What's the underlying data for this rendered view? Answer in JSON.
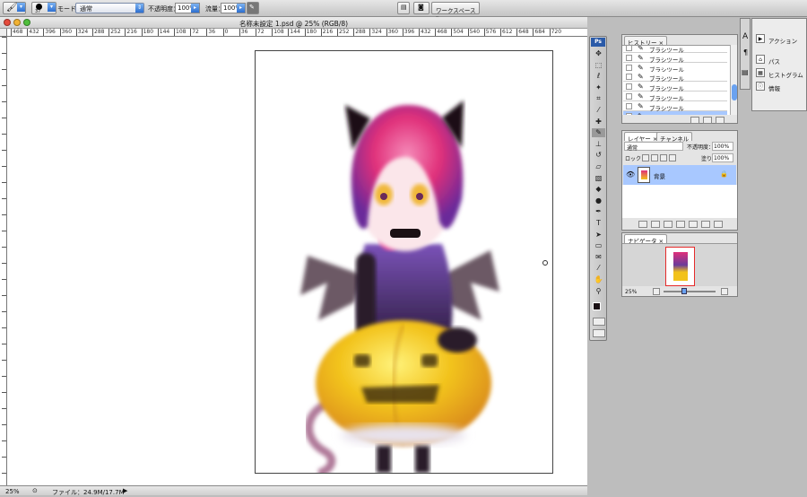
{
  "options_bar": {
    "brush_size": "37",
    "mode_label": "モード：",
    "mode_value": "通常",
    "opacity_label": "不透明度：",
    "opacity_value": "100%",
    "flow_label": "流量：",
    "flow_value": "100%",
    "workspace_label": "ワークスペース ▾"
  },
  "window": {
    "title": "名称未設定 1.psd @ 25% (RGB/8)"
  },
  "ruler": {
    "top_labels": [
      "468",
      "432",
      "396",
      "360",
      "324",
      "288",
      "252",
      "216",
      "180",
      "144",
      "108",
      "72",
      "36",
      "0",
      "36",
      "72",
      "108",
      "144",
      "180",
      "216",
      "252",
      "288",
      "324",
      "360",
      "396",
      "432",
      "468",
      "504",
      "540",
      "576",
      "612",
      "648",
      "684",
      "720"
    ]
  },
  "status": {
    "zoom": "25%",
    "file_info": "ファイル：24.9M/17.7M"
  },
  "tools": {
    "logo": "Ps",
    "items": [
      "move",
      "marquee",
      "lasso",
      "magic-wand",
      "crop",
      "slice",
      "healing",
      "brush",
      "stamp",
      "history-brush",
      "eraser",
      "gradient",
      "blur",
      "dodge",
      "pen",
      "type",
      "path-select",
      "shape",
      "notes",
      "eyedropper",
      "hand",
      "zoom"
    ]
  },
  "history_panel": {
    "tab": "ヒストリー",
    "rows": [
      "ブラシツール",
      "ブラシツール",
      "ブラシツール",
      "ブラシツール",
      "ブラシツール",
      "ブラシツール",
      "ブラシツール",
      "ブラシツール"
    ]
  },
  "layers_panel": {
    "tabs": [
      "レイヤー",
      "チャンネル"
    ],
    "blend_mode": "通常",
    "opacity_label": "不透明度：",
    "opacity_value": "100%",
    "lock_label": "ロック：",
    "fill_label": "塗り：",
    "fill_value": "100%",
    "layer_name": "背景"
  },
  "navigator_panel": {
    "tab": "ナビゲータ",
    "zoom": "25%"
  },
  "right_dock": {
    "items": [
      "アクション",
      "パス",
      "ヒストグラム",
      "情報"
    ]
  },
  "colors": {
    "selection": "#a8c8ff",
    "accent_blue": "#2d6fd0",
    "foreground": "#111111",
    "background": "#ffffff"
  }
}
